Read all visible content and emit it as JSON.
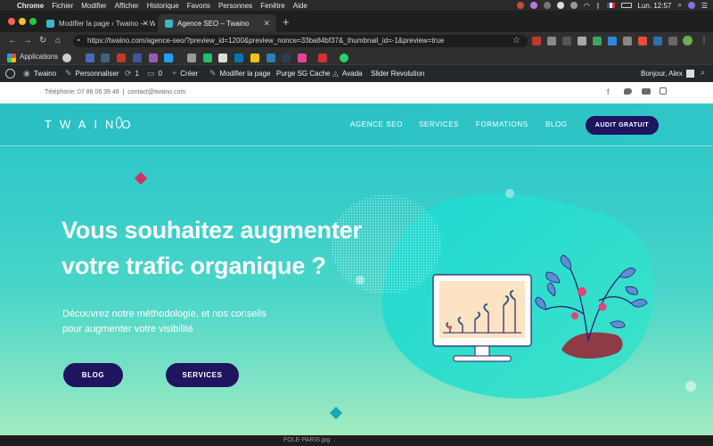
{
  "menubar": {
    "items": [
      "Chrome",
      "Fichier",
      "Modifier",
      "Afficher",
      "Historique",
      "Favoris",
      "Personnes",
      "Fenêtre",
      "Aide"
    ],
    "clock": "Lun. 12:57",
    "flag": "FR"
  },
  "tabs": [
    {
      "title": "Modifier la page ‹ Twaino — W"
    },
    {
      "title": "Agence SEO – Twaino"
    }
  ],
  "address": {
    "url": "https://twaino.com/agence-seo/?preview_id=1200&preview_nonce=33ba84bf37&_thumbnail_id=-1&preview=true"
  },
  "bookmarks": {
    "apps_label": "Applications"
  },
  "adminbar": {
    "site": "Twaino",
    "customize": "Personnaliser",
    "updates_count": "1",
    "comments_count": "0",
    "new_label": "Créer",
    "edit_page": "Modifier la page",
    "purge": "Purge SG Cache",
    "avada": "Avada",
    "slider": "Slider Revolution",
    "greeting": "Bonjour, Alex"
  },
  "site": {
    "topbar_contact": "Téléphone: 07 86 06 39 48  |  contact@twaino.com",
    "logo": "TWAINO",
    "nav": [
      "AGENCE SEO",
      "SERVICES",
      "FORMATIONS",
      "BLOG"
    ],
    "cta": "AUDIT GRATUIT",
    "hero_title_line1": "Vous souhaitez augmenter",
    "hero_title_line2": "votre trafic organique ?",
    "hero_sub_line1": "Découvrez notre méthodologie, et nos conseils",
    "hero_sub_line2": "pour augmenter votre visibilité",
    "btn_blog": "BLOG",
    "btn_services": "SERVICES"
  },
  "bottom": {
    "filename": "FOLE-PARIS.jpg"
  },
  "colors": {
    "brand_teal": "#2bc4c6",
    "cta_navy": "#1f1460",
    "admin_bar": "#23282d"
  }
}
